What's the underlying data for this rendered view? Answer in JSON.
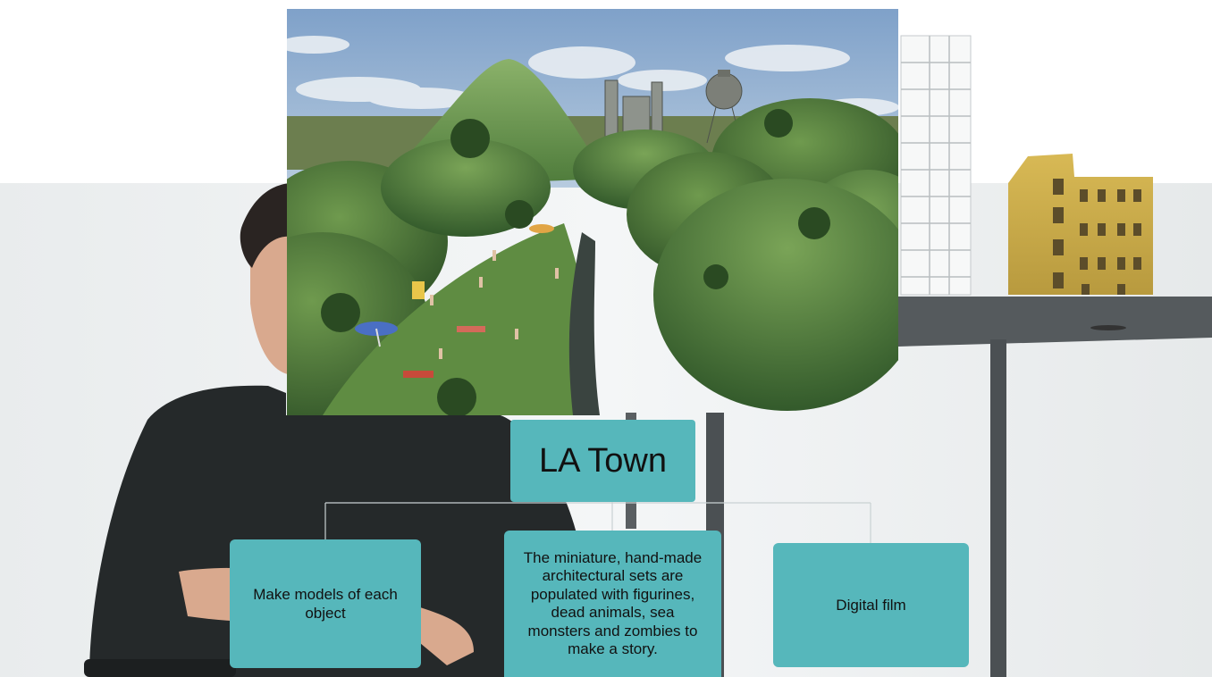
{
  "diagram": {
    "root": {
      "label": "LA Town"
    },
    "children": [
      {
        "label": "Make models of each object"
      },
      {
        "label": "The miniature, hand-made architectural sets are populated with figurines, dead animals, sea monsters and zombies to make a story."
      },
      {
        "label": "Digital film"
      }
    ]
  },
  "colors": {
    "node_fill": "#56b7bb",
    "connector": "#c9d1d3",
    "background": "#f2f4f5"
  },
  "images": {
    "background": "photo of artist seated beside a table holding miniature building models",
    "foreground": "miniature landscape model with green hills, figurines, a stream and industrial towers"
  }
}
